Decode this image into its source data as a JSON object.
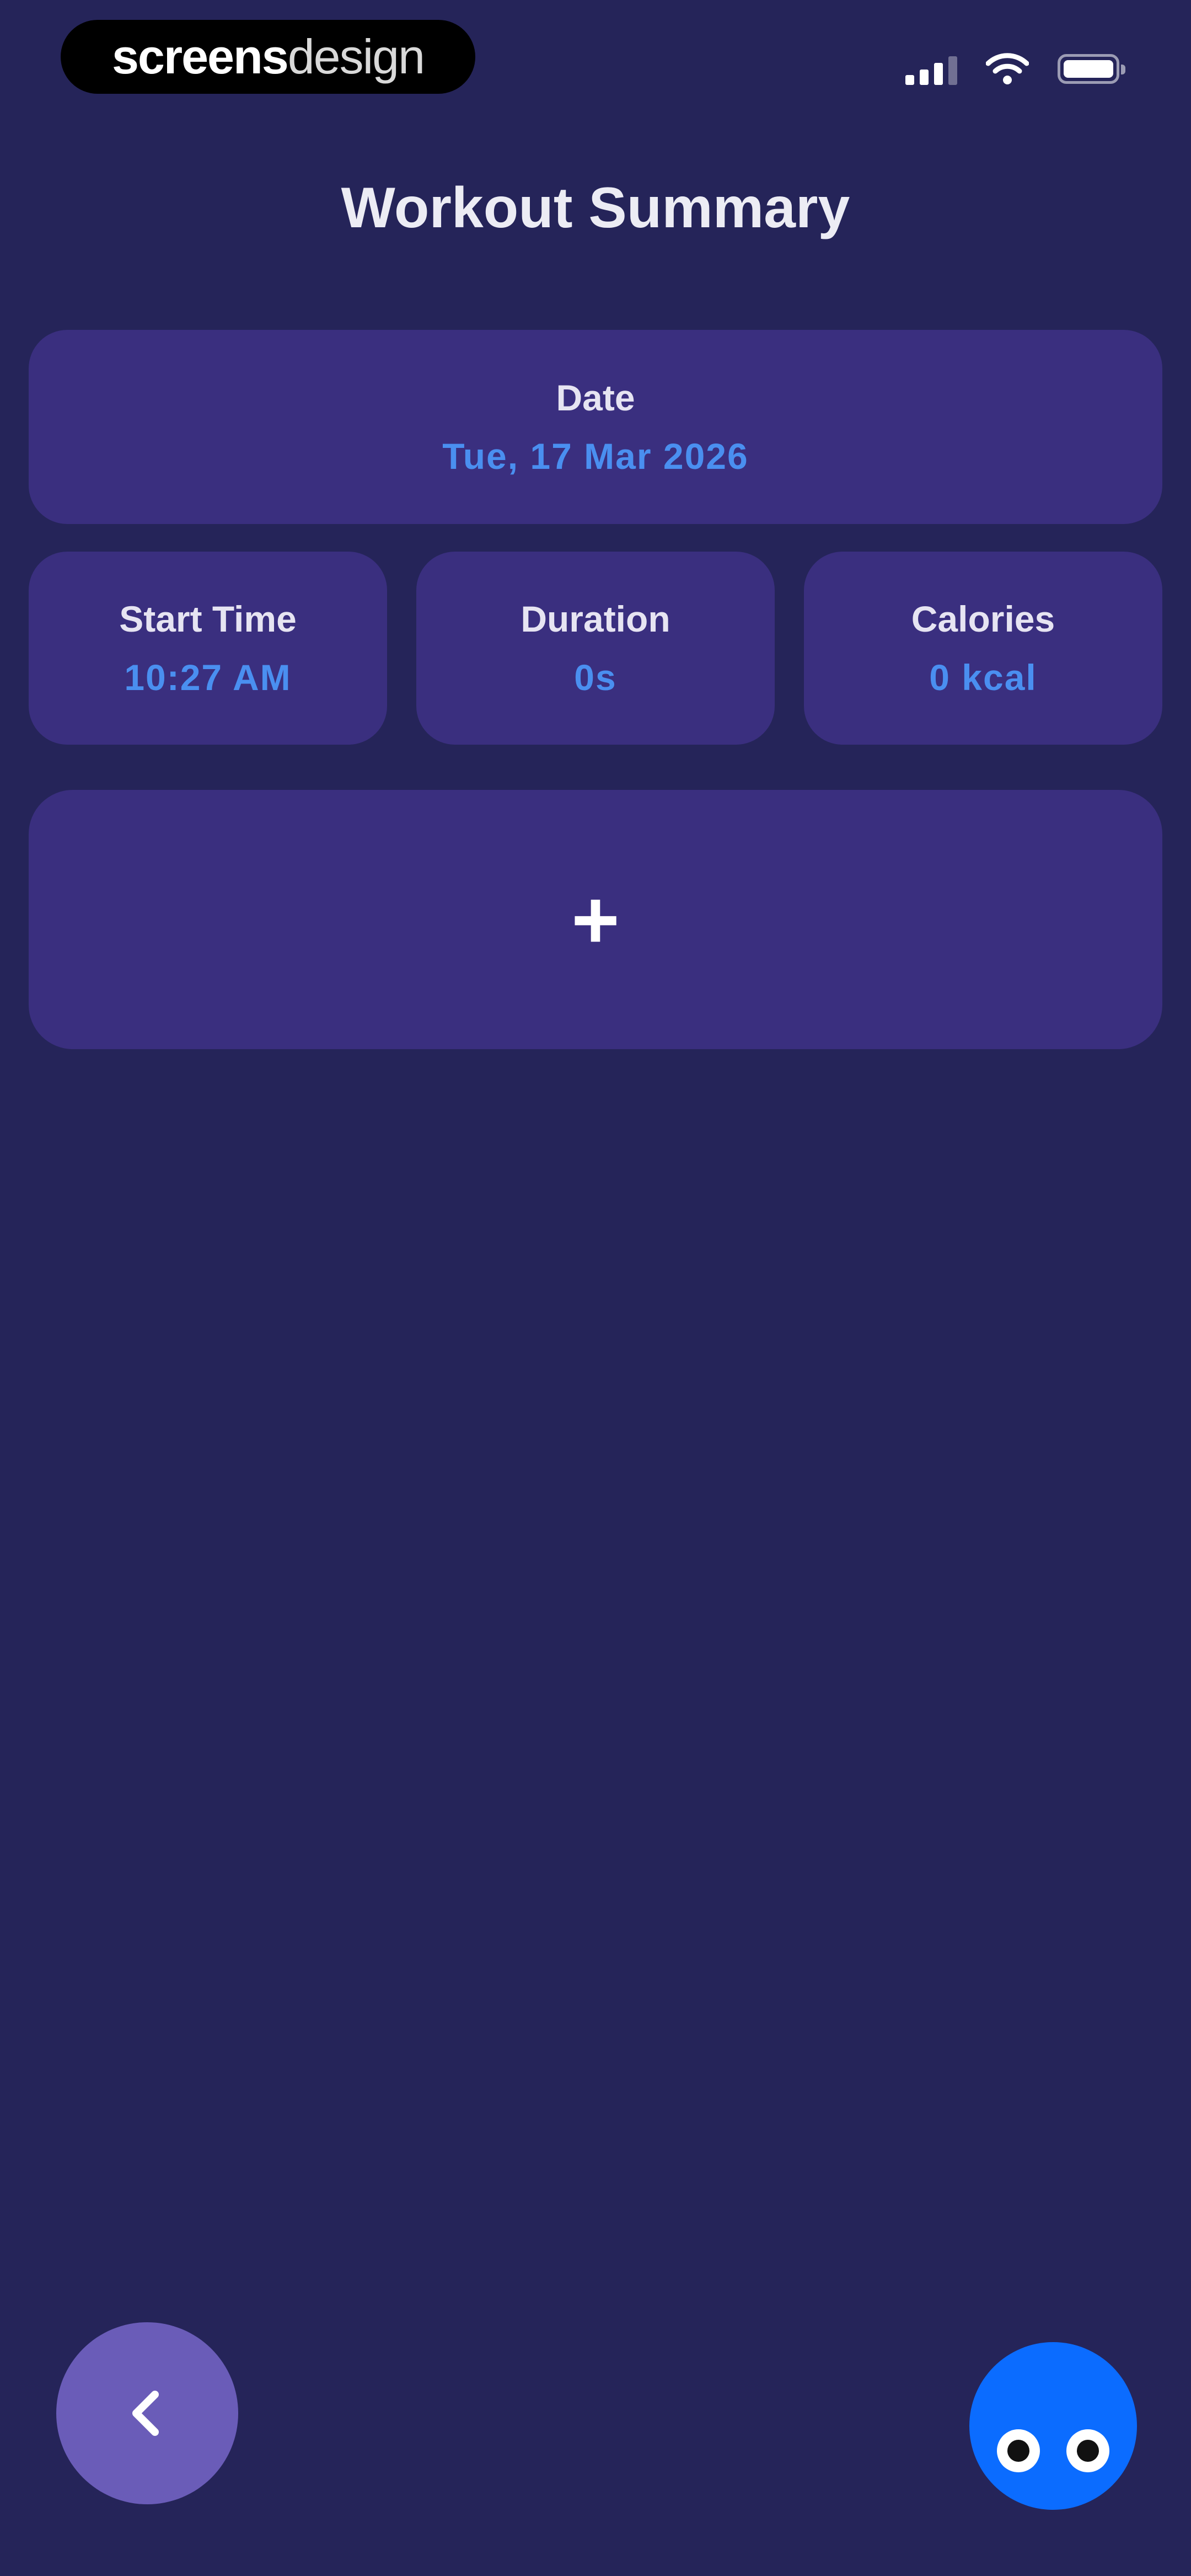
{
  "status_bar": {
    "brand_strong": "screens",
    "brand_light": "design",
    "icons": [
      "signal-icon",
      "wifi-icon",
      "battery-icon"
    ]
  },
  "header": {
    "title": "Workout Summary"
  },
  "summary": {
    "date": {
      "label": "Date",
      "value": "Tue, 17 Mar 2026"
    },
    "start_time": {
      "label": "Start Time",
      "value": "10:27 AM"
    },
    "duration": {
      "label": "Duration",
      "value": "0s"
    },
    "calories": {
      "label": "Calories",
      "value": "0 kcal"
    }
  },
  "add_card": {
    "symbol": "+",
    "icon": "plus-icon"
  },
  "bottom": {
    "back_icon": "chevron-left-icon",
    "assistant_icon": "eyes-icon"
  },
  "colors": {
    "background": "#252459",
    "card": "#3a2f7f",
    "accent_value": "#4a8ff0",
    "back_button": "#6a5cb8",
    "assistant_button": "#0b6cff"
  }
}
